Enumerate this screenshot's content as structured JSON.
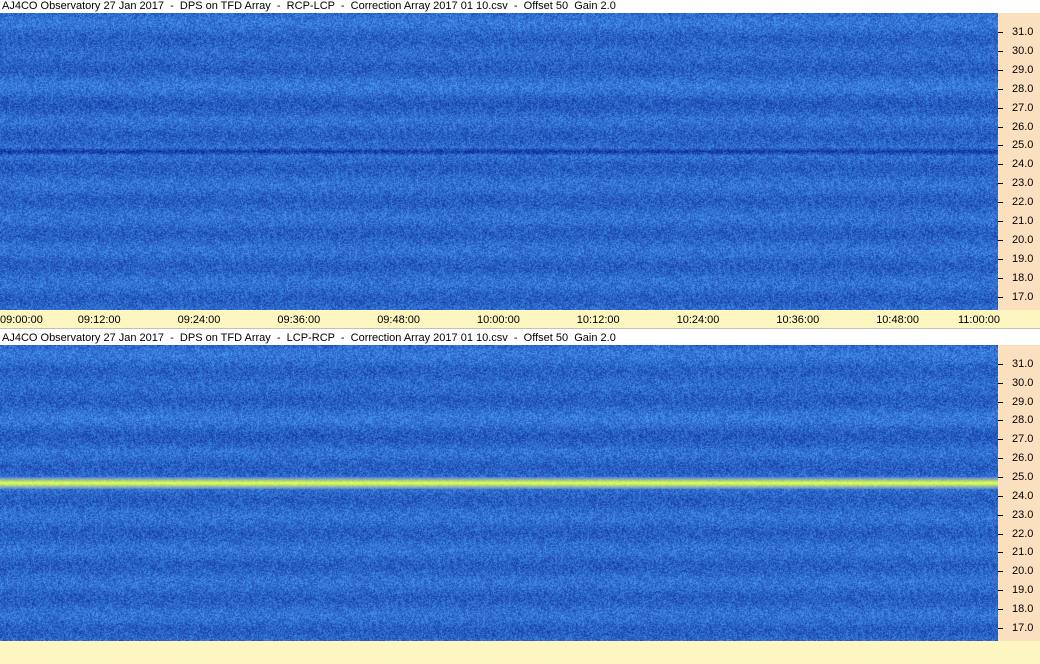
{
  "colors": {
    "axis_bg": "#fbe0c0",
    "time_bg": "#fdf6c0",
    "base_blue": "#2a5fe0",
    "dark_band": "#0a1a70",
    "bright_band": "#a0f070"
  },
  "chart_data": [
    {
      "type": "heatmap",
      "title": "AJ4CO Observatory 27 Jan 2017  -  DPS on TFD Array  -  RCP-LCP  -  Correction Array 2017 01 10.csv  -  Offset 50  Gain 2.0",
      "x_ticks": [
        "09:00:00",
        "09:12:00",
        "09:24:00",
        "09:36:00",
        "09:48:00",
        "10:00:00",
        "10:12:00",
        "10:24:00",
        "10:36:00",
        "10:48:00",
        "11:00:00"
      ],
      "y_ticks": [
        "31.0",
        "30.0",
        "29.0",
        "28.0",
        "27.0",
        "26.0",
        "25.0",
        "24.0",
        "23.0",
        "22.0",
        "21.0",
        "20.0",
        "19.0",
        "18.0",
        "17.0"
      ],
      "ylim": [
        16.3,
        32.0
      ],
      "band_freq": 24.7,
      "band_style": "dark"
    },
    {
      "type": "heatmap",
      "title": "AJ4CO Observatory 27 Jan 2017  -  DPS on TFD Array  -  LCP-RCP  -  Correction Array 2017 01 10.csv  -  Offset 50  Gain 2.0",
      "x_ticks": [],
      "y_ticks": [
        "31.0",
        "30.0",
        "29.0",
        "28.0",
        "27.0",
        "26.0",
        "25.0",
        "24.0",
        "23.0",
        "22.0",
        "21.0",
        "20.0",
        "19.0",
        "18.0",
        "17.0"
      ],
      "ylim": [
        16.3,
        32.0
      ],
      "band_freq": 24.7,
      "band_style": "bright"
    }
  ]
}
